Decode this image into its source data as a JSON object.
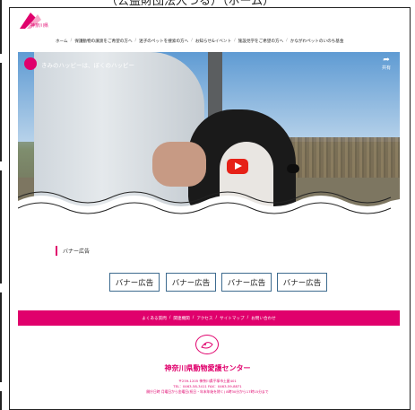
{
  "page_caption": "（公益財団法人つる）（ホーム）",
  "header": {
    "logo_text": "神奈川県",
    "nav": [
      "ホーム",
      "保護動物の譲渡をご希望の方へ",
      "迷子のペットを捜索の方へ",
      "お知らせ&イベント",
      "施設見学をご希望の方へ",
      "かながわペットのいのち基金"
    ]
  },
  "video": {
    "title": "きみのハッピーは、ぼくのハッピー",
    "share_label": "共有"
  },
  "banner_section": {
    "title": "バナー広告",
    "banners": [
      "バナー広告",
      "バナー広告",
      "バナー広告",
      "バナー広告"
    ]
  },
  "footer": {
    "links": [
      "よくある質問",
      "関連機関",
      "アクセス",
      "サイトマップ",
      "お問い合わせ"
    ],
    "org_name": "神奈川県動物愛護センター",
    "info": [
      "〒259-1205 神奈川県平塚市土屋401",
      "TEL：0463-58-3411 FAX：0463-59-8871",
      "開庁日時 月曜日から金曜日(祝日・年末年始を除く) 8時30分から17時15分まで"
    ]
  },
  "colors": {
    "accent": "#e0006c",
    "banner_border": "#3d6b8f",
    "youtube_red": "#e62117"
  }
}
